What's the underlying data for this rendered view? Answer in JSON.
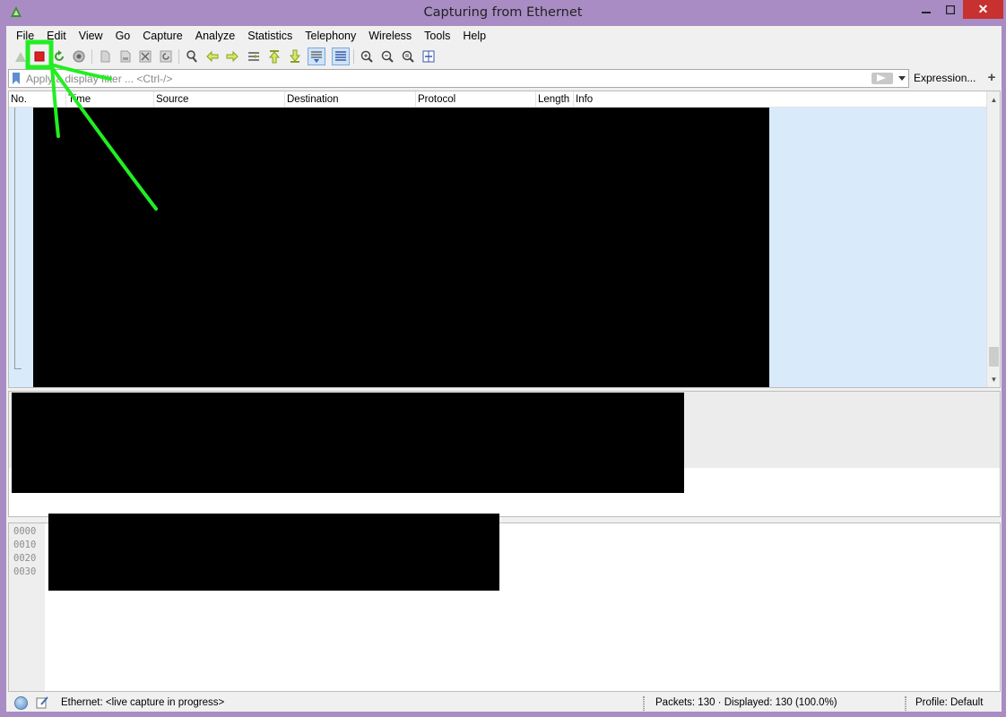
{
  "window": {
    "title": "Capturing from Ethernet",
    "close_label": "✕"
  },
  "menu": {
    "items": [
      "File",
      "Edit",
      "View",
      "Go",
      "Capture",
      "Analyze",
      "Statistics",
      "Telephony",
      "Wireless",
      "Tools",
      "Help"
    ]
  },
  "toolbar": {
    "buttons": [
      "start-capture-icon",
      "stop-capture-icon",
      "restart-capture-icon",
      "capture-options-icon",
      "open-file-icon",
      "save-file-icon",
      "close-file-icon",
      "reload-file-icon",
      "find-packet-icon",
      "go-back-icon",
      "go-forward-icon",
      "go-to-packet-icon",
      "go-first-packet-icon",
      "go-last-packet-icon",
      "autoscroll-icon",
      "colorize-icon",
      "zoom-in-icon",
      "zoom-out-icon",
      "normal-size-icon",
      "resize-columns-icon"
    ]
  },
  "filter": {
    "placeholder": "Apply a display filter ... <Ctrl-/>",
    "expression_label": "Expression...",
    "add_label": "+"
  },
  "packet_list": {
    "columns": [
      "No.",
      "Time",
      "Source",
      "Destination",
      "Protocol",
      "Length",
      "Info"
    ]
  },
  "bytes": {
    "offsets": [
      "0000",
      "0010",
      "0020",
      "0030"
    ]
  },
  "status": {
    "interface_text": "Ethernet: <live capture in progress>",
    "packets_text": "Packets: 130 · Displayed: 130 (100.0%)",
    "profile_text": "Profile: Default"
  },
  "colors": {
    "annotation_green": "#22ee22",
    "selection_blue": "#d9eafb",
    "close_red": "#c7312f",
    "stop_red": "#e11f1f"
  }
}
